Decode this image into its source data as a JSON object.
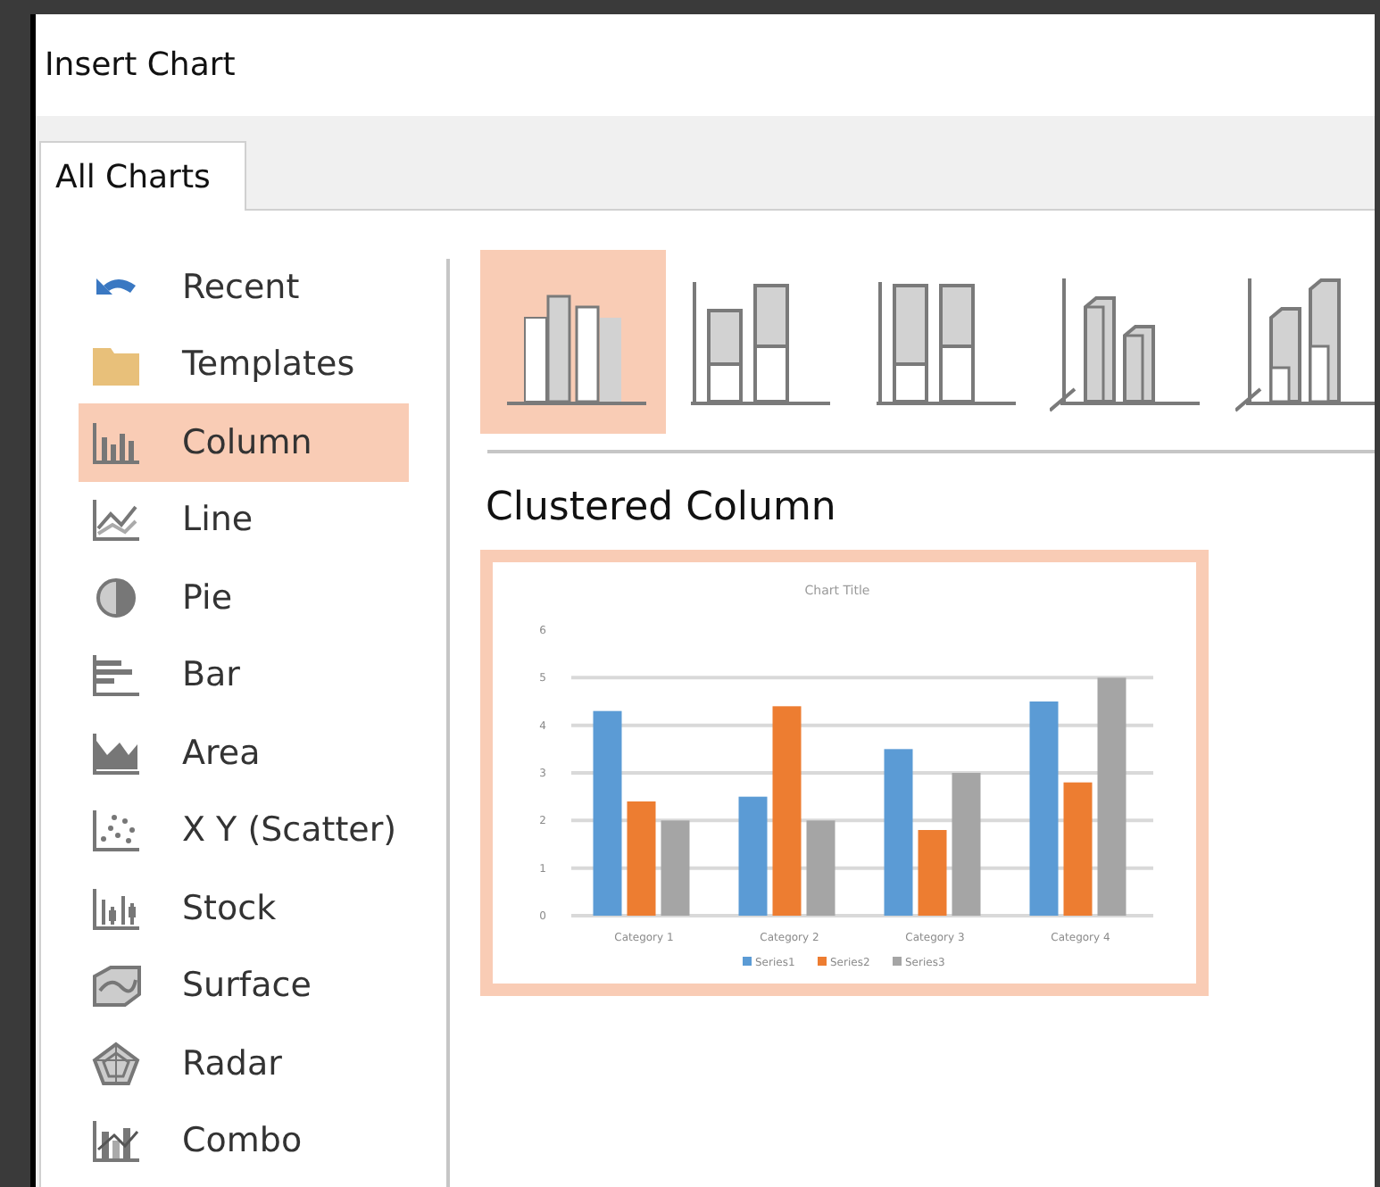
{
  "window": {
    "title": "Insert Chart"
  },
  "tabs": [
    {
      "label": "All Charts",
      "selected": true
    }
  ],
  "sidebar": {
    "items": [
      {
        "label": "Recent",
        "selected": false
      },
      {
        "label": "Templates",
        "selected": false
      },
      {
        "label": "Column",
        "selected": true
      },
      {
        "label": "Line",
        "selected": false
      },
      {
        "label": "Pie",
        "selected": false
      },
      {
        "label": "Bar",
        "selected": false
      },
      {
        "label": "Area",
        "selected": false
      },
      {
        "label": "X Y (Scatter)",
        "selected": false
      },
      {
        "label": "Stock",
        "selected": false
      },
      {
        "label": "Surface",
        "selected": false
      },
      {
        "label": "Radar",
        "selected": false
      },
      {
        "label": "Combo",
        "selected": false
      }
    ]
  },
  "chart_types": [
    {
      "selected": true
    },
    {
      "selected": false
    },
    {
      "selected": false
    },
    {
      "selected": false
    },
    {
      "selected": false
    }
  ],
  "preview": {
    "heading": "Clustered Column",
    "chart_data": {
      "type": "bar",
      "title": "Chart Title",
      "categories": [
        "Category 1",
        "Category 2",
        "Category 3",
        "Category 4"
      ],
      "series": [
        {
          "name": "Series1",
          "color": "#5b9bd5",
          "values": [
            4.3,
            2.5,
            3.5,
            4.5
          ]
        },
        {
          "name": "Series2",
          "color": "#ed7d31",
          "values": [
            2.4,
            4.4,
            1.8,
            2.8
          ]
        },
        {
          "name": "Series3",
          "color": "#a5a5a5",
          "values": [
            2,
            2,
            3,
            5
          ]
        }
      ],
      "ylim": [
        0,
        6
      ],
      "yticks": [
        0,
        1,
        2,
        3,
        4,
        5,
        6
      ],
      "grid": true,
      "legend": "bottom"
    }
  }
}
